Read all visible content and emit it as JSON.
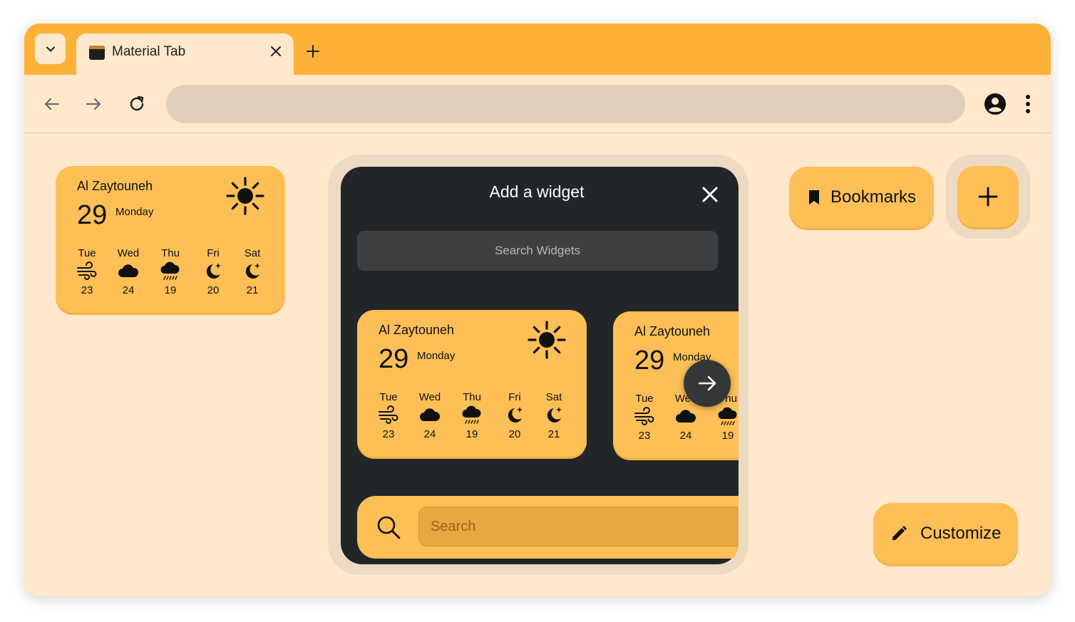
{
  "browser": {
    "tab_title": "Material Tab",
    "accent_color": "#fdb237",
    "background_color": "#ffe8cc"
  },
  "toolbar": {
    "back_icon": "arrow-left",
    "forward_icon": "arrow-right",
    "reload_icon": "reload",
    "profile_icon": "account-circle",
    "menu_icon": "more-vertical",
    "address_value": ""
  },
  "weather_widget": {
    "location": "Al Zaytouneh",
    "date_number": "29",
    "weekday": "Monday",
    "current_icon": "sun",
    "forecast": [
      {
        "day": "Tue",
        "icon": "wind",
        "temp": "23"
      },
      {
        "day": "Wed",
        "icon": "cloud",
        "temp": "24"
      },
      {
        "day": "Thu",
        "icon": "rain",
        "temp": "19"
      },
      {
        "day": "Fri",
        "icon": "moon-stars",
        "temp": "20"
      },
      {
        "day": "Sat",
        "icon": "moon-stars",
        "temp": "21"
      }
    ]
  },
  "modal": {
    "title": "Add a widget",
    "search_placeholder": "Search Widgets",
    "preview_search_placeholder": "Search"
  },
  "buttons": {
    "bookmarks_label": "Bookmarks",
    "customize_label": "Customize"
  }
}
